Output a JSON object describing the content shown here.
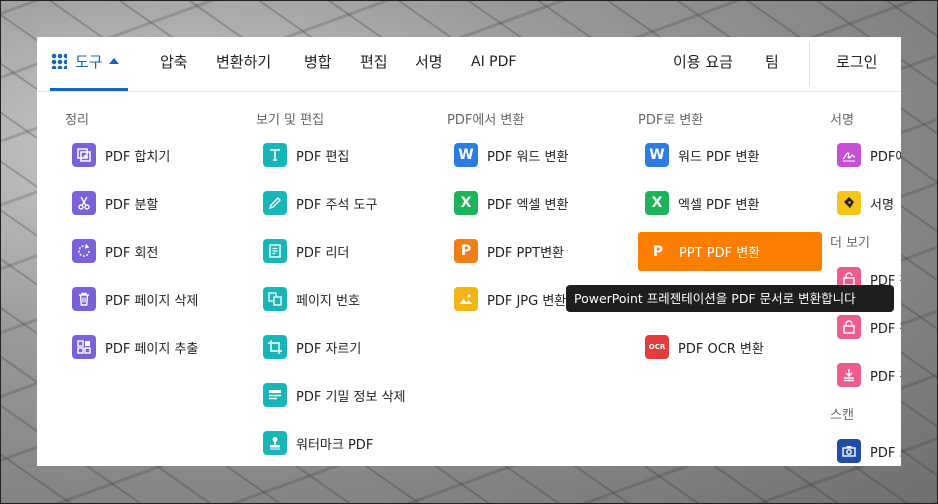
{
  "nav": {
    "tools": "도구",
    "compress": "압축",
    "convert": "변환하기",
    "merge": "병합",
    "edit": "편집",
    "sign": "서명",
    "ai_pdf": "AI PDF",
    "pricing": "이용 요금",
    "team": "팀",
    "login": "로그인"
  },
  "columns": {
    "organize": {
      "title": "정리",
      "items": [
        "PDF 합치기",
        "PDF 분할",
        "PDF 회전",
        "PDF 페이지 삭제",
        "PDF 페이지 추출"
      ]
    },
    "view_edit": {
      "title": "보기 및 편집",
      "items": [
        "PDF 편집",
        "PDF 주석 도구",
        "PDF 리더",
        "페이지 번호",
        "PDF 자르기",
        "PDF 기밀 정보 삭제",
        "워터마크 PDF"
      ]
    },
    "from_pdf": {
      "title": "PDF에서 변환",
      "items": [
        "PDF 워드 변환",
        "PDF 엑셀 변환",
        "PDF PPT변환",
        "PDF JPG 변환"
      ]
    },
    "to_pdf": {
      "title": "PDF로 변환",
      "items": [
        "워드 PDF 변환",
        "엑셀 PDF 변환",
        "PPT PDF 변환",
        "PDF OCR 변환"
      ]
    },
    "sign": {
      "title": "서명",
      "items": [
        "PDF에",
        "서명"
      ]
    },
    "more": {
      "title": "더 보기",
      "items": [
        "PDF 잠",
        "PDF 잠",
        "PDF 평"
      ]
    },
    "scan": {
      "title": "스캔",
      "items": [
        "PDF 스"
      ]
    }
  },
  "icons": {
    "word_letter": "W",
    "excel_letter": "X",
    "ppt_letter": "P",
    "ocr_letter": "OCR"
  },
  "tooltip": "PowerPoint 프레젠테이션을 PDF 문서로 변환합니다",
  "colors": {
    "accent": "#1565c0",
    "highlight": "#fd7e00"
  }
}
